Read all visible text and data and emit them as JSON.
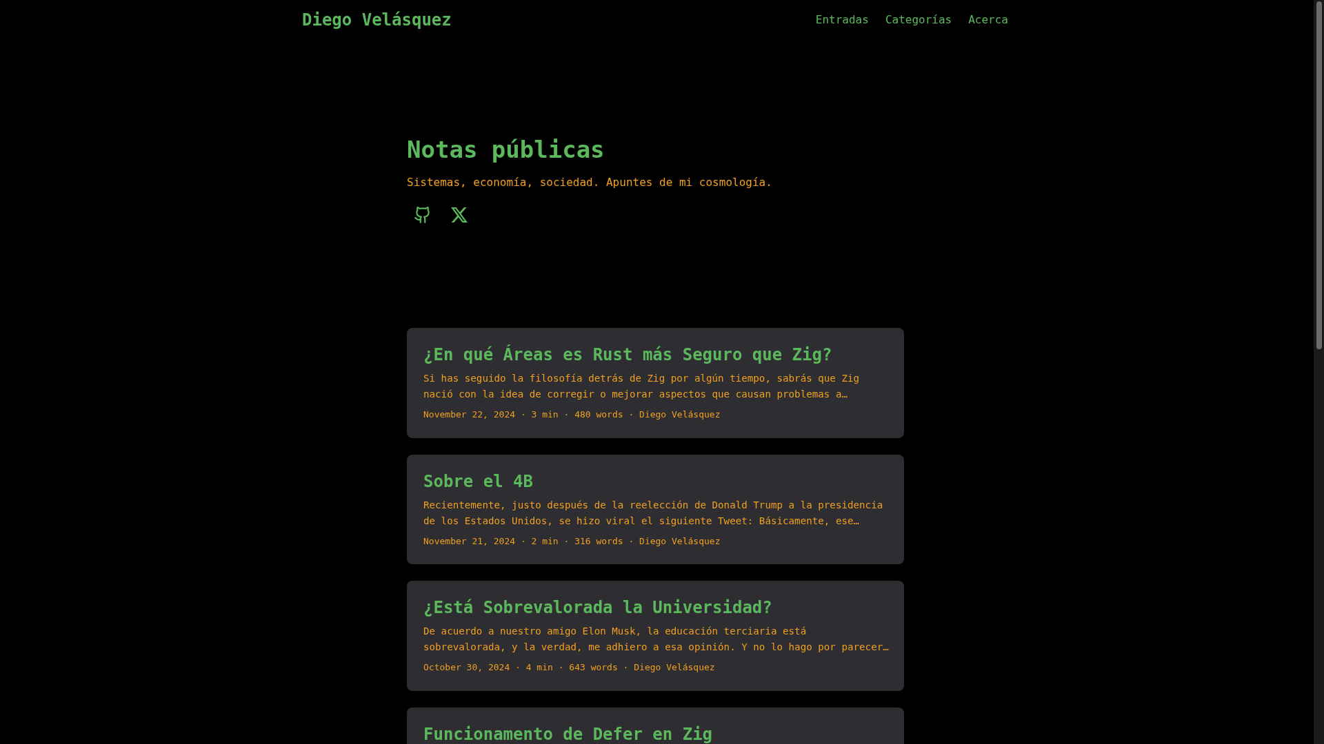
{
  "header": {
    "site_title": "Diego Velásquez",
    "nav": [
      {
        "label": "Entradas"
      },
      {
        "label": "Categorías"
      },
      {
        "label": "Acerca"
      }
    ]
  },
  "hero": {
    "title": "Notas públicas",
    "subtitle": "Sistemas, economía, sociedad. Apuntes de mi cosmología.",
    "social": [
      {
        "kind": "github"
      },
      {
        "kind": "x"
      }
    ]
  },
  "posts": [
    {
      "title": "¿En qué Áreas es Rust más Seguro que Zig?",
      "summary": "Si has seguido la filosofía detrás de Zig por algún tiempo, sabrás que Zig nació con la idea de corregir o mejorar aspectos que causan problemas a…",
      "meta": "November 22, 2024 · 3 min · 480 words · Diego Velásquez"
    },
    {
      "title": "Sobre el 4B",
      "summary": "Recientemente, justo después de la reelección de Donald Trump a la presidencia de los Estados Unidos, se hizo viral el siguiente Tweet: Básicamente, ese…",
      "meta": "November 21, 2024 · 2 min · 316 words · Diego Velásquez"
    },
    {
      "title": "¿Está Sobrevalorada la Universidad?",
      "summary": "De acuerdo a nuestro amigo Elon Musk, la educación terciaria está sobrevalorada, y la verdad, me adhiero a esa opinión. Y no lo hago por parecer…",
      "meta": "October 30, 2024 · 4 min · 643 words · Diego Velásquez"
    },
    {
      "title": "Funcionamento de Defer en Zig"
    }
  ]
}
